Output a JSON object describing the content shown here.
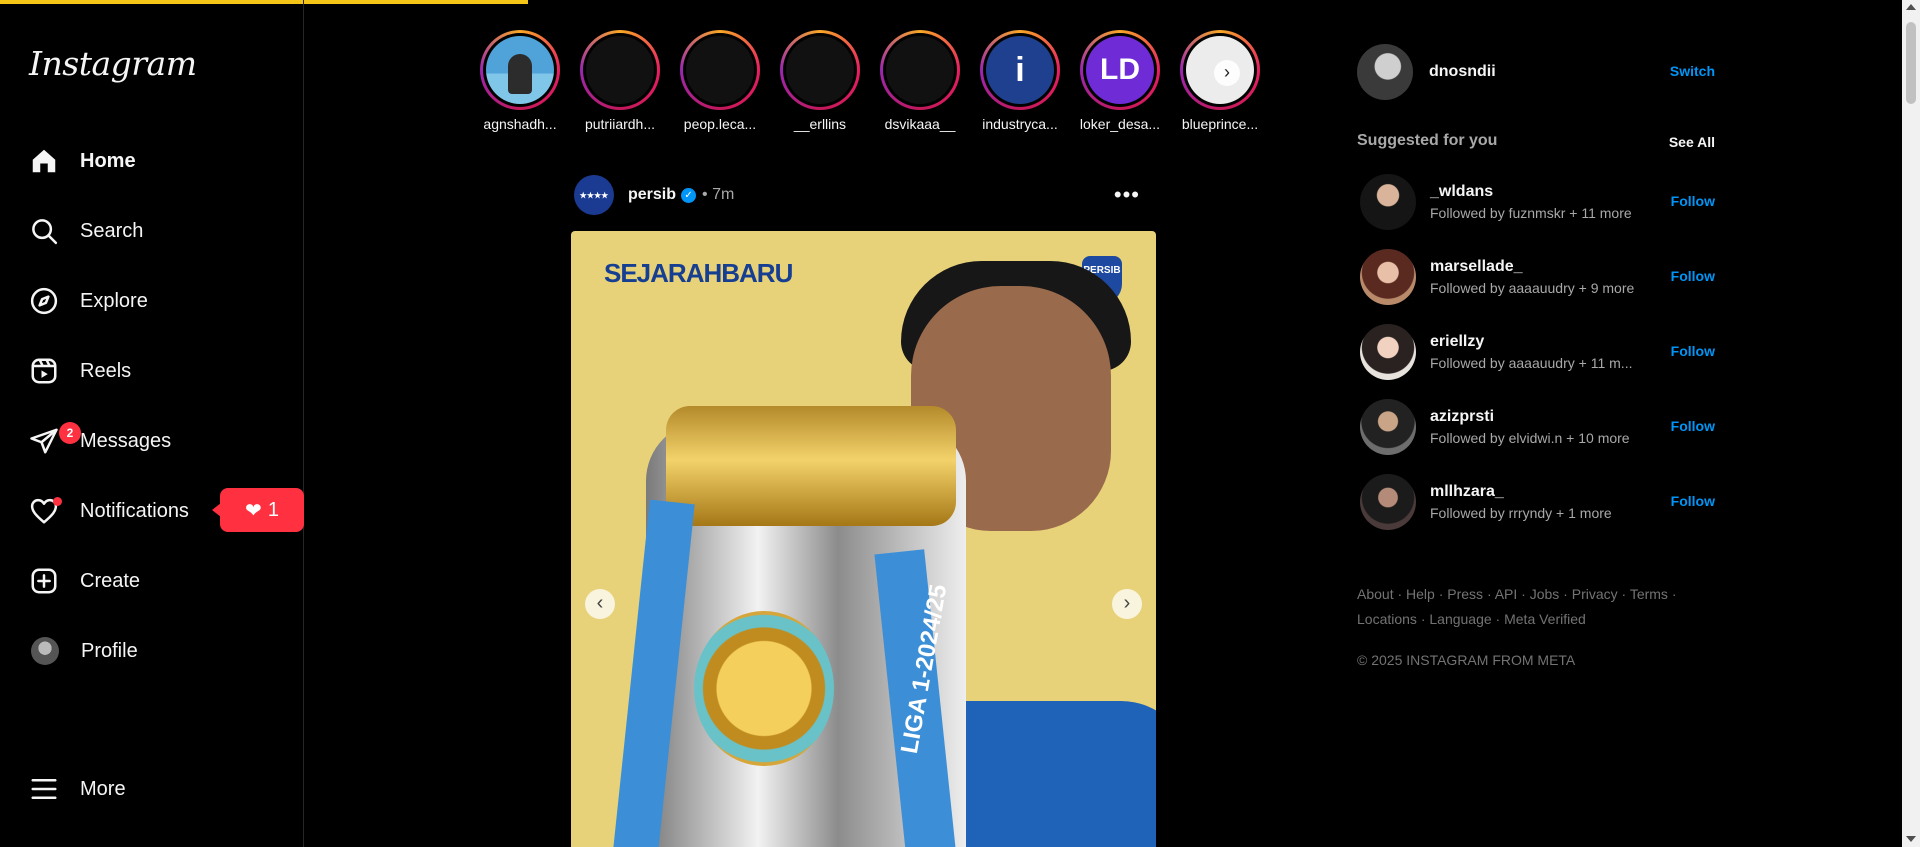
{
  "app": {
    "logo": "Instagram"
  },
  "nav": [
    {
      "label": "Home",
      "icon": "home-icon"
    },
    {
      "label": "Search",
      "icon": "search-icon"
    },
    {
      "label": "Explore",
      "icon": "compass-icon"
    },
    {
      "label": "Reels",
      "icon": "reels-icon"
    },
    {
      "label": "Messages",
      "icon": "messenger-icon",
      "badge": "2"
    },
    {
      "label": "Notifications",
      "icon": "heart-icon",
      "popup": "1"
    },
    {
      "label": "Create",
      "icon": "plus-square-icon"
    },
    {
      "label": "Profile",
      "icon": "avatar"
    },
    {
      "label": "More",
      "icon": "menu-icon"
    }
  ],
  "stories": [
    {
      "name": "agnshadh..."
    },
    {
      "name": "putriiardh..."
    },
    {
      "name": "peop.leca..."
    },
    {
      "name": "__erllins"
    },
    {
      "name": "dsvikaaa__"
    },
    {
      "name": "industryca..."
    },
    {
      "name": "loker_desa...",
      "initials": "LD"
    },
    {
      "name": "blueprince..."
    }
  ],
  "post": {
    "username": "persib",
    "time": "7m",
    "separator": "•",
    "image_brand": "SEJARAHBARU",
    "image_crest": "PERSIB",
    "ribbon_text": "LIGA 1-2024/25"
  },
  "me": {
    "username": "dnosndii",
    "switch": "Switch"
  },
  "suggested": {
    "title": "Suggested for you",
    "see_all": "See All",
    "items": [
      {
        "username": "_wldans",
        "sub": "Followed by fuznmskr + 11 more",
        "action": "Follow"
      },
      {
        "username": "marsellade_",
        "sub": "Followed by aaaauudry + 9 more",
        "action": "Follow"
      },
      {
        "username": "eriellzy",
        "sub": "Followed by aaaauudry + 11 m...",
        "action": "Follow"
      },
      {
        "username": "azizprsti",
        "sub": "Followed by elvidwi.n + 10 more",
        "action": "Follow"
      },
      {
        "username": "mllhzara_",
        "sub": "Followed by rrryndy + 1 more",
        "action": "Follow"
      }
    ]
  },
  "footer": {
    "links_line1": "About · Help · Press · API · Jobs · Privacy · Terms ·",
    "links_line2": "Locations · Language · Meta Verified",
    "copyright": "© 2025 INSTAGRAM FROM META"
  },
  "colors": {
    "accent": "#0095f6",
    "badge": "#ff3040",
    "loadbar": "#f5c518"
  },
  "page_load_progress": 0.275
}
